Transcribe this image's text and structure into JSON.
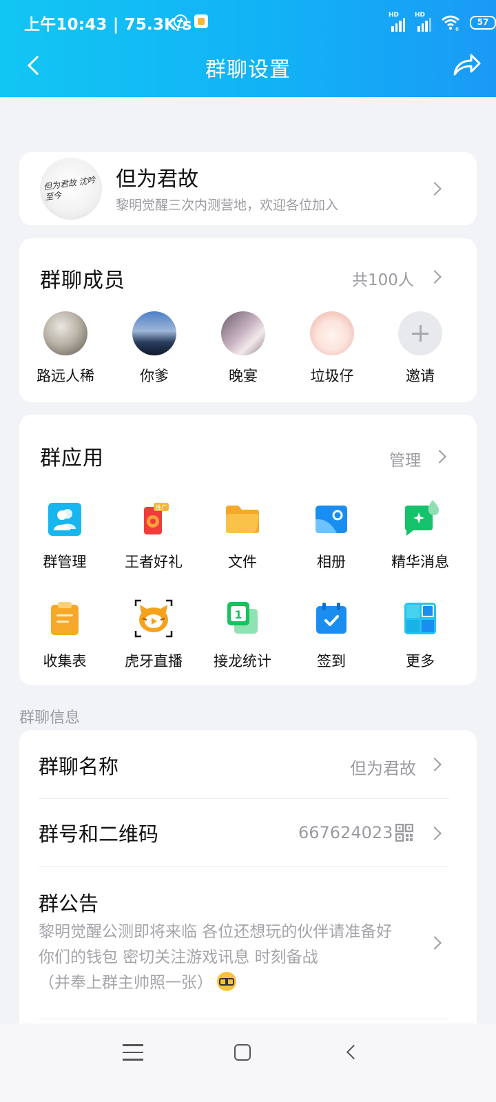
{
  "status_bar": {
    "time_speed": "上午10:43 | 75.3K/s",
    "signal_1_label": "HD",
    "signal_2_label": "HD",
    "wifi_label": "6",
    "battery": "57"
  },
  "header": {
    "title": "群聊设置"
  },
  "group": {
    "name": "但为君故",
    "description": "黎明觉醒三次内测营地，欢迎各位加入"
  },
  "members": {
    "title": "群聊成员",
    "count": "共100人",
    "items": [
      {
        "name": "路远人稀"
      },
      {
        "name": "你爹"
      },
      {
        "name": "晚宴"
      },
      {
        "name": "垃圾仔"
      },
      {
        "name": "邀请"
      }
    ]
  },
  "apps": {
    "title": "群应用",
    "manage": "管理",
    "ad_badge": "推广",
    "calendar_badge": "1",
    "items": [
      {
        "name": "群管理",
        "icon": "group-admin-icon"
      },
      {
        "name": "王者好礼",
        "icon": "gift-icon"
      },
      {
        "name": "文件",
        "icon": "folder-icon"
      },
      {
        "name": "相册",
        "icon": "album-icon"
      },
      {
        "name": "精华消息",
        "icon": "essence-message-icon"
      },
      {
        "name": "收集表",
        "icon": "clipboard-icon"
      },
      {
        "name": "虎牙直播",
        "icon": "huya-live-icon"
      },
      {
        "name": "接龙统计",
        "icon": "relay-count-icon"
      },
      {
        "name": "签到",
        "icon": "checkin-calendar-icon"
      },
      {
        "name": "更多",
        "icon": "more-grid-icon"
      }
    ]
  },
  "info": {
    "section_label": "群聊信息",
    "name_label": "群聊名称",
    "name_value": "但为君故",
    "id_label": "群号和二维码",
    "id_value": "667624023",
    "notice_label": "群公告",
    "notice_line1": "黎明觉醒公测即将来临 各位还想玩的伙伴请准备好",
    "notice_line2": "你们的钱包 密切关注游戏讯息 时刻备战",
    "notice_line3": "（并奉上群主帅照一张）"
  },
  "colors": {
    "header_gradient_start": "#12c6f3",
    "header_gradient_end": "#1a9af6",
    "background": "#f2f3f7",
    "secondary_text": "#9a9ba0"
  }
}
